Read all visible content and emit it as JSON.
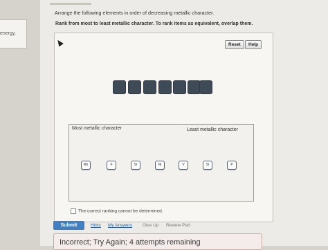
{
  "sidebar": {
    "fragment": "energy,"
  },
  "question": {
    "instruction": "Arrange the following elements in order of decreasing metallic character.",
    "rank_instruction": "Rank from most to least metallic character. To rank items as equivalent, overlap them."
  },
  "toolbar": {
    "reset_label": "Reset",
    "help_label": "Help"
  },
  "ranking": {
    "most_label": "Most metallic character",
    "least_label": "Least metallic character",
    "slot_count": 7
  },
  "elements": [
    {
      "symbol": "Rb"
    },
    {
      "symbol": "F"
    },
    {
      "symbol": "Sr"
    },
    {
      "symbol": "Ni"
    },
    {
      "symbol": "V"
    },
    {
      "symbol": "Si"
    },
    {
      "symbol": "P"
    }
  ],
  "options": {
    "cannot_determine": "The correct ranking cannot be determined."
  },
  "actions": {
    "submit_label": "Submit",
    "hints_label": "Hints",
    "my_answers_label": "My Answers",
    "give_up_label": "Give Up",
    "review_part_label": "Review Part"
  },
  "feedback": {
    "text": "Incorrect; Try Again; 4 attempts remaining"
  },
  "colors": {
    "accent": "#3f7fc3",
    "slot": "#3f4a57"
  }
}
